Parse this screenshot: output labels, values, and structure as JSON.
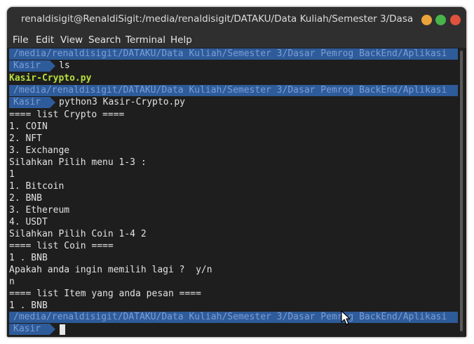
{
  "window": {
    "title": "renaldisigit@RenaldiSigit:/media/renaldisigit/DATAKU/Data Kuliah/Semester 3/Dasa...",
    "buttons": {
      "minimize": "minimize",
      "maximize": "maximize",
      "close": "close"
    }
  },
  "menu": [
    "File",
    "Edit",
    "View",
    "Search",
    "Terminal",
    "Help"
  ],
  "terminal": {
    "path": "/media/renaldisigit/DATAKU/Data Kuliah/Semester 3/Dasar Pemrog BackEnd/Aplikasi",
    "prompt_label": "Kasir",
    "commands": [
      "ls",
      "python3 Kasir-Crypto.py"
    ],
    "ls_output": "Kasir-Crypto.py",
    "output_lines": [
      "==== list Crypto ====",
      "1. COIN",
      "2. NFT",
      "3. Exchange",
      "Silahkan Pilih menu 1-3 :",
      "1",
      "1. Bitcoin",
      "2. BNB",
      "3. Ethereum",
      "4. USDT",
      "Silahkan Pilih Coin 1-4 2",
      "==== list Coin ====",
      "1 . BNB",
      "Apakah anda ingin memilih lagi ?  y/n",
      "n",
      "==== list Item yang anda pesan ====",
      "1 . BNB"
    ]
  },
  "colors": {
    "background": "#1e1e1e",
    "prompt_bg": "#2e5b9a",
    "prompt_fg": "#7c9ed4",
    "filename": "#b8e03a",
    "text": "#e2e2e2"
  }
}
